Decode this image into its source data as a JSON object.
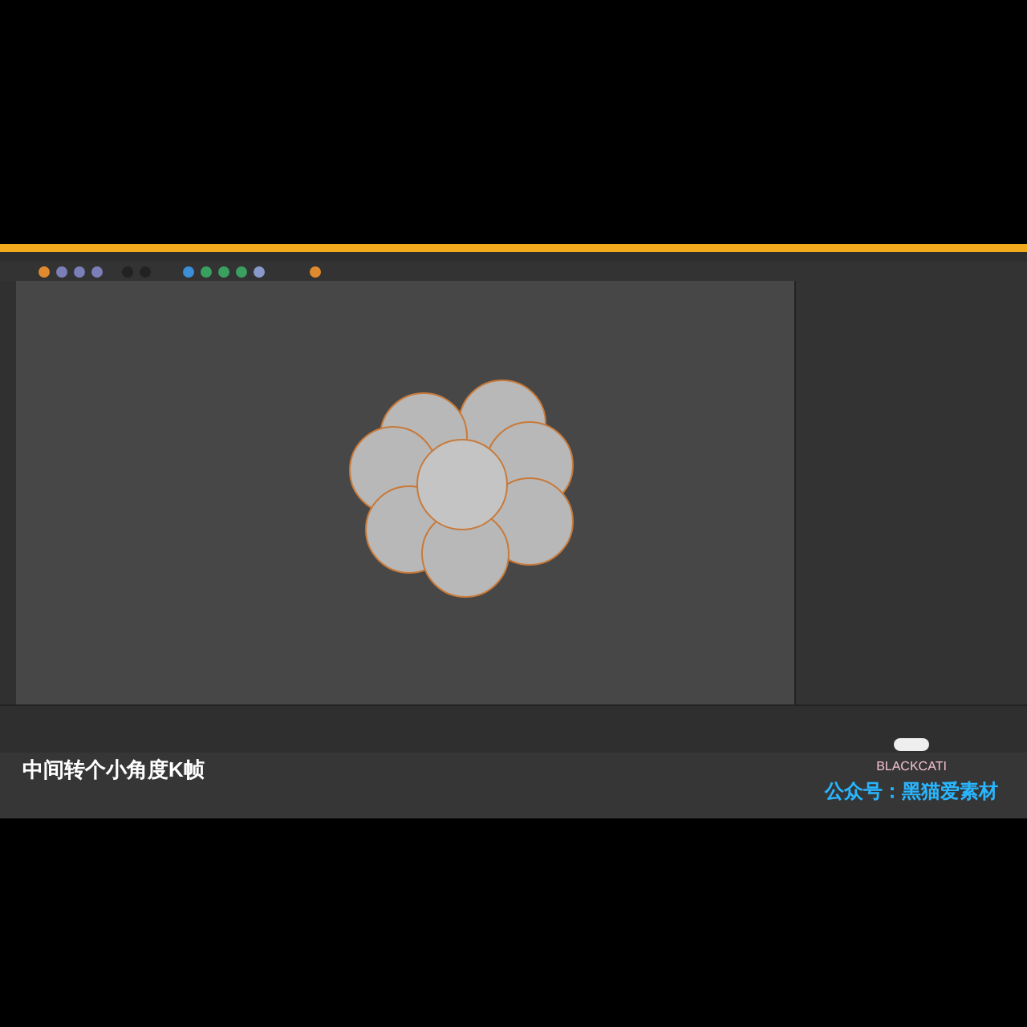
{
  "subtitle": "中间转个小角度K帧",
  "logo": {
    "text": "BLACKCATI"
  },
  "account": "公众号：黑猫爱素材"
}
